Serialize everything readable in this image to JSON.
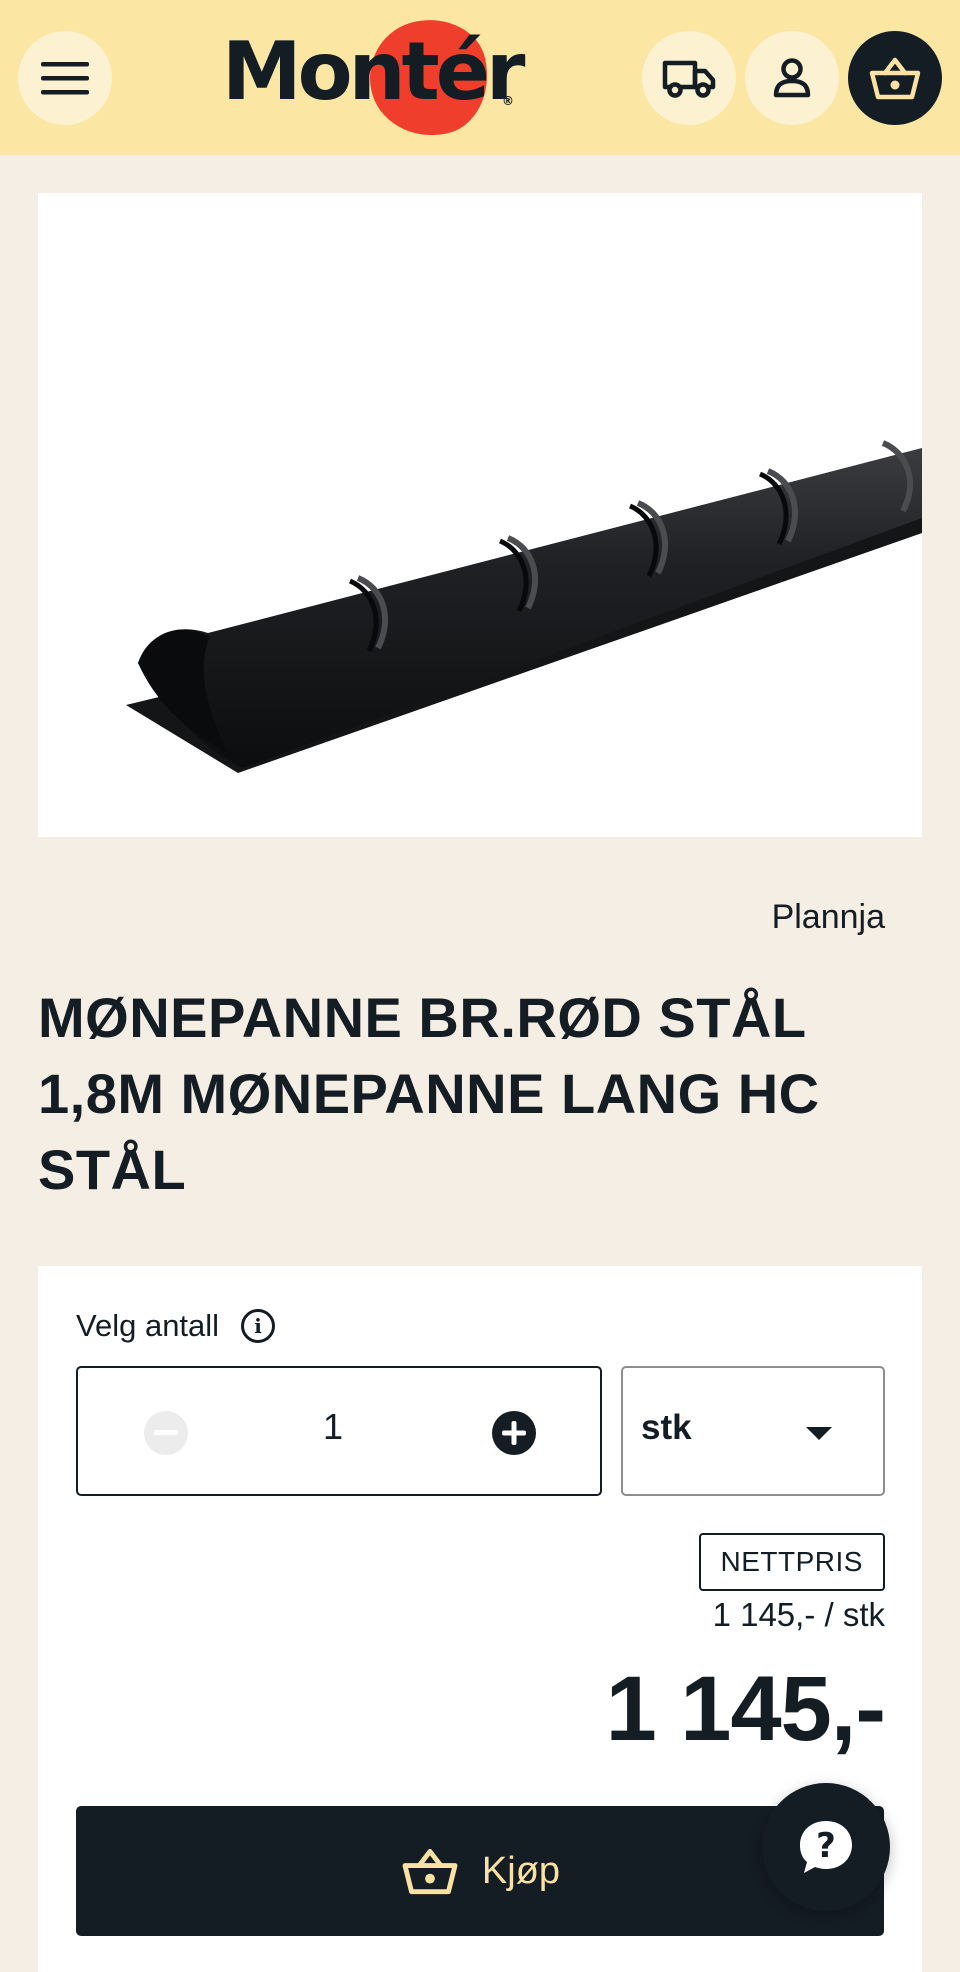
{
  "header": {
    "logo_text": "Montér",
    "logo_mark": "®",
    "menu_icon": "hamburger-menu-icon",
    "delivery_icon": "delivery-truck-icon",
    "account_icon": "user-icon",
    "cart_icon": "shopping-basket-icon"
  },
  "product": {
    "image_alt": "Black steel ridge tile",
    "brand": "Plannja",
    "title": "MØNEPANNE BR.RØD STÅL 1,8M MØNEPANNE LANG HC STÅL"
  },
  "purchase": {
    "quantity_label": "Velg antall",
    "quantity_value": "1",
    "unit": "stk",
    "price_badge": "NETTPRIS",
    "unit_price": "1 145,- / stk",
    "total_price": "1 145,-",
    "buy_label": "Kjøp"
  },
  "colors": {
    "header_bg": "#fbe7a3",
    "page_bg": "#f5eee5",
    "dark": "#141c24",
    "logo_accent": "#ef3f2c",
    "buy_text": "#fbe2a2"
  }
}
